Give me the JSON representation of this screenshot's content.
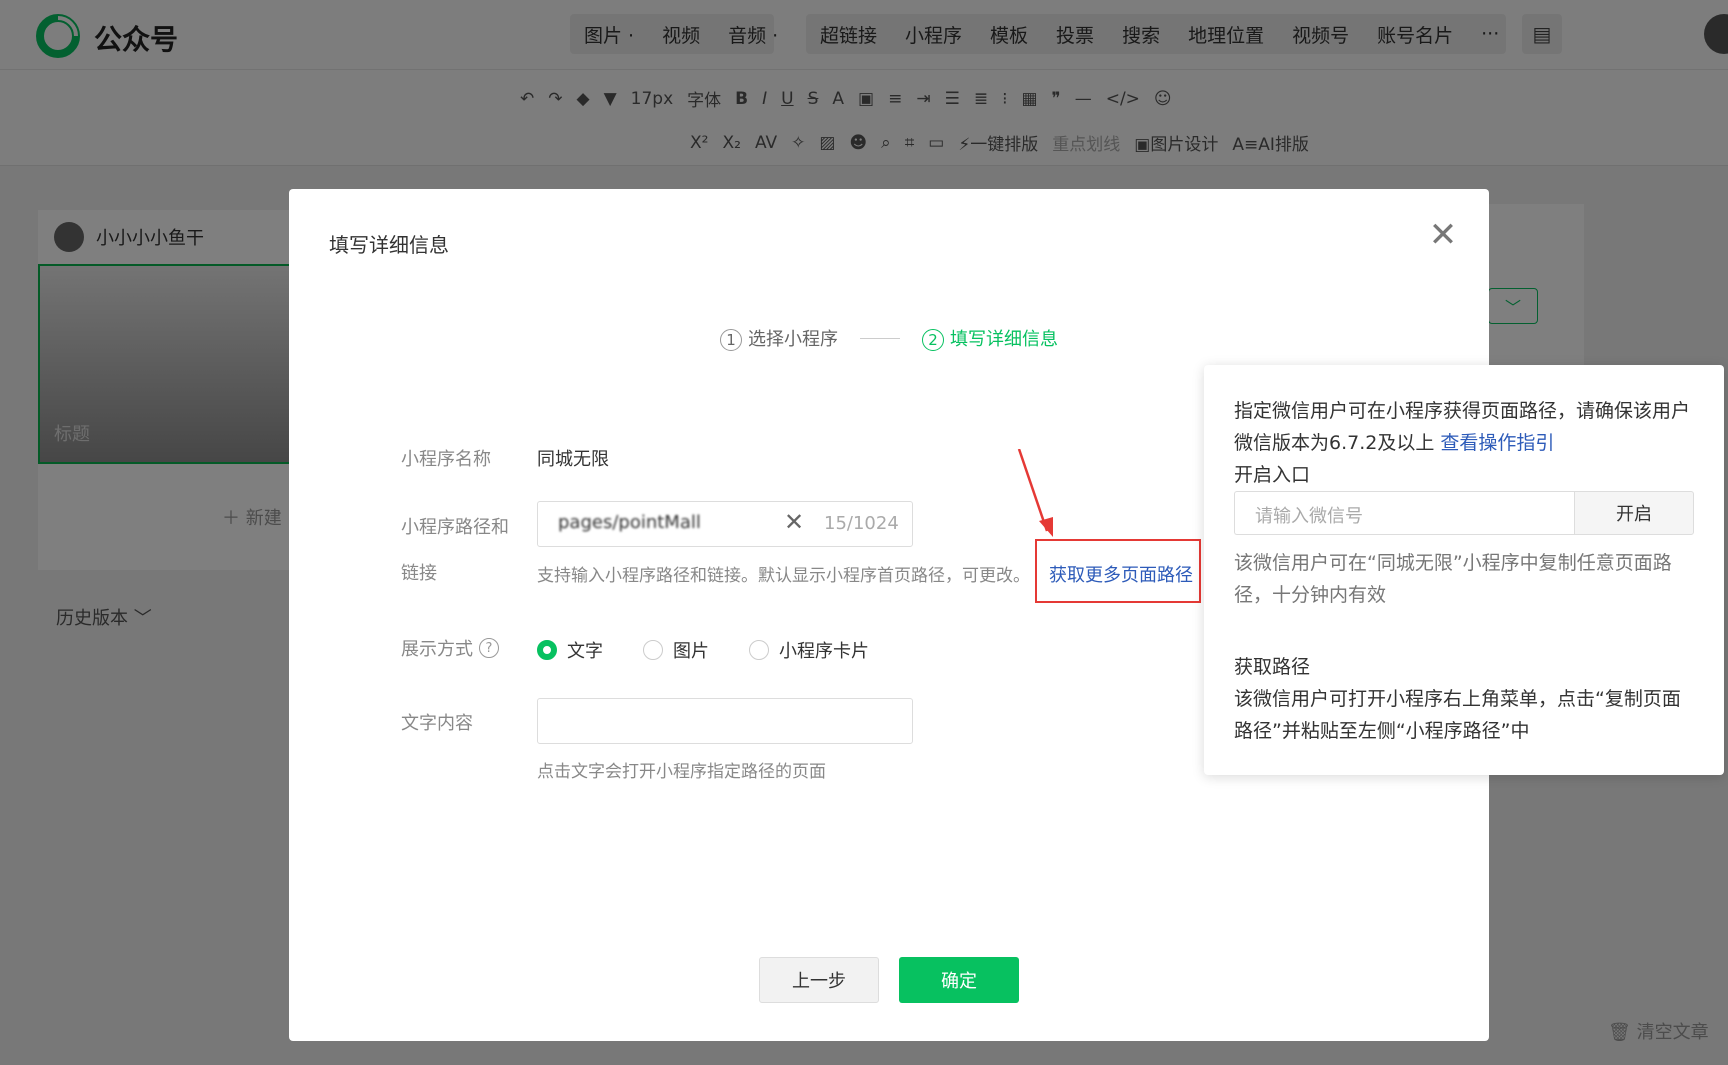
{
  "app": {
    "brand": "公众号"
  },
  "topmenu": {
    "group1": [
      "图片 ·",
      "视频",
      "音频 ·"
    ],
    "group2": [
      "超链接",
      "小程序",
      "模板",
      "投票",
      "搜索",
      "地理位置",
      "视频号",
      "账号名片",
      "···"
    ]
  },
  "toolbar": {
    "font_size": "17px",
    "font_family": "字体",
    "one_click_layout": "一键排版",
    "highlight_line": "重点划线",
    "image_design": "图片设计",
    "ai_layout": "AI排版"
  },
  "editor": {
    "username": "小小小小鱼干",
    "cover_title": "标题",
    "new_label": "新建",
    "history": "历史版本",
    "clear_article": "清空文章"
  },
  "modal": {
    "title": "填写详细信息",
    "steps": [
      {
        "num": "1",
        "label": "选择小程序"
      },
      {
        "num": "2",
        "label": "填写详细信息"
      }
    ],
    "name_label": "小程序名称",
    "name_value": "同城无限",
    "path_label_1": "小程序路径和",
    "path_label_2": "链接",
    "path_value": "pages/pointMall",
    "path_count": "15/1024",
    "path_hint": "支持输入小程序路径和链接。默认显示小程序首页路径，可更改。",
    "more_path_link": "获取更多页面路径",
    "display_label": "展示方式",
    "display_options": [
      "文字",
      "图片",
      "小程序卡片"
    ],
    "text_label": "文字内容",
    "text_hint": "点击文字会打开小程序指定路径的页面",
    "prev_button": "上一步",
    "ok_button": "确定"
  },
  "popover": {
    "intro": "指定微信用户可在小程序获得页面路径，请确保该用户微信版本为6.7.2及以上",
    "guide_link": "查看操作指引",
    "open_entry_title": "开启入口",
    "wx_placeholder": "请输入微信号",
    "open_button": "开启",
    "open_note": "该微信用户可在“同城无限”小程序中复制任意页面路径，十分钟内有效",
    "get_path_title": "获取路径",
    "get_path_desc": "该微信用户可打开小程序右上角菜单，点击“复制页面路径”并粘贴至左侧“小程序路径”中"
  },
  "colors": {
    "accent": "#07c160",
    "link": "#2d5bb9",
    "highlight_box": "#e53935"
  }
}
